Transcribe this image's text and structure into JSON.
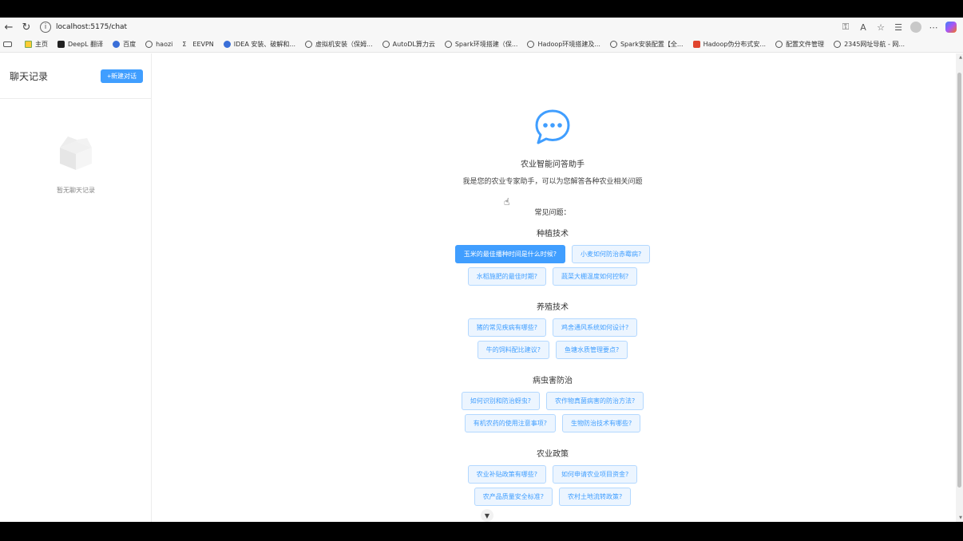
{
  "browser": {
    "url": "localhost:5175/chat",
    "bookmarks": [
      {
        "label": "主页",
        "icon": "home-icon"
      },
      {
        "label": "DeepL 翻译",
        "icon": "deepl-icon"
      },
      {
        "label": "百度",
        "icon": "baidu-icon"
      },
      {
        "label": "haozi",
        "icon": "globe-icon"
      },
      {
        "label": "EEVPN",
        "icon": "sigma-icon"
      },
      {
        "label": "IDEA 安装、破解和...",
        "icon": "idea-icon"
      },
      {
        "label": "虚拟机安装（保姆...",
        "icon": "globe-icon"
      },
      {
        "label": "AutoDL算力云",
        "icon": "globe-icon"
      },
      {
        "label": "Spark环境搭建（保...",
        "icon": "globe-icon"
      },
      {
        "label": "Hadoop环境搭建及...",
        "icon": "globe-icon"
      },
      {
        "label": "Spark安装配置【全...",
        "icon": "globe-icon"
      },
      {
        "label": "Hadoop伪分布式安...",
        "icon": "csdn-icon"
      },
      {
        "label": "配置文件管理",
        "icon": "globe-icon"
      },
      {
        "label": "2345网址导航 - 网...",
        "icon": "globe-icon"
      }
    ]
  },
  "sidebar": {
    "title": "聊天记录",
    "new_chat_label": "+新建对话",
    "empty_text": "暂无聊天记录"
  },
  "welcome": {
    "title": "农业智能问答助手",
    "subtitle": "我是您的农业专家助手，可以为您解答各种农业相关问题",
    "faq_title": "常见问题："
  },
  "categories": [
    {
      "title": "种植技术",
      "rows": [
        [
          "玉米的最佳播种时间是什么时候?",
          "小麦如何防治赤霉病?"
        ],
        [
          "水稻施肥的最佳时期?",
          "蔬菜大棚温度如何控制?"
        ]
      ]
    },
    {
      "title": "养殖技术",
      "rows": [
        [
          "猪的常见疾病有哪些?",
          "鸡舍通风系统如何设计?"
        ],
        [
          "牛的饲料配比建议?",
          "鱼塘水质管理要点?"
        ]
      ]
    },
    {
      "title": "病虫害防治",
      "rows": [
        [
          "如何识别和防治蚜虫?",
          "农作物真菌病害的防治方法?"
        ],
        [
          "有机农药的使用注意事项?",
          "生物防治技术有哪些?"
        ]
      ]
    },
    {
      "title": "农业政策",
      "rows": [
        [
          "农业补贴政策有哪些?",
          "如何申请农业项目资金?"
        ],
        [
          "农产品质量安全标准?",
          "农村土地流转政策?"
        ]
      ]
    }
  ],
  "active_question": "玉米的最佳播种时间是什么时候?",
  "colors": {
    "accent": "#409eff",
    "accent_light": "#ecf5ff"
  }
}
